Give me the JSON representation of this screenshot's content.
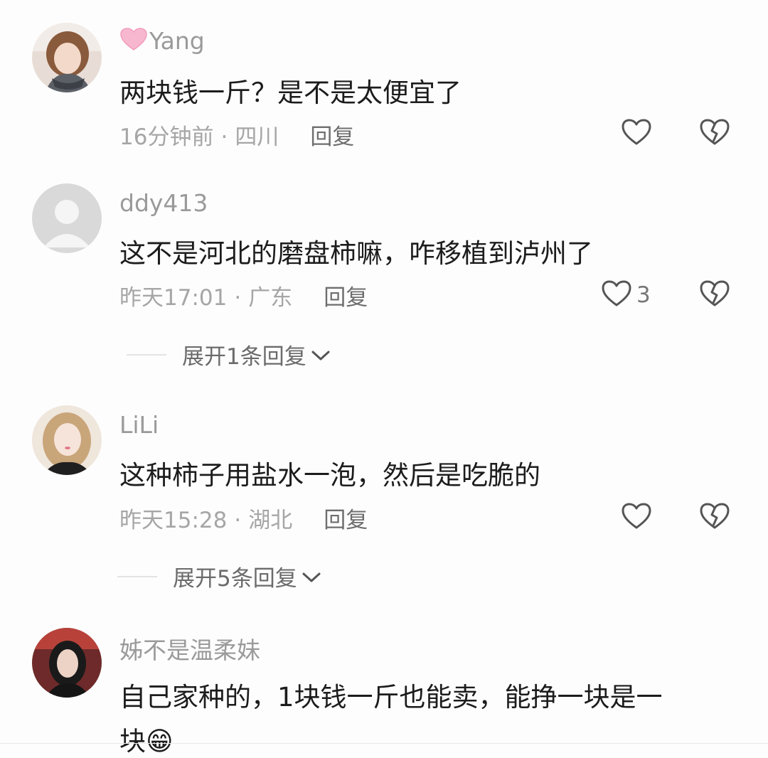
{
  "comments": [
    {
      "username": "Yang",
      "username_prefix_icon": "pink-heart-icon",
      "text": "两块钱一斤？是不是太便宜了",
      "time": "16分钟前",
      "location": "四川",
      "reply_label": "回复",
      "like_count": ""
    },
    {
      "username": "ddy413",
      "text": "这不是河北的磨盘柿嘛，咋移植到泸州了",
      "time": "昨天17:01",
      "location": "广东",
      "reply_label": "回复",
      "like_count": "3",
      "expand_label": "展开1条回复"
    },
    {
      "username": "LiLi",
      "text": "这种柿子用盐水一泡，然后是吃脆的",
      "time": "昨天15:28",
      "location": "湖北",
      "reply_label": "回复",
      "like_count": "",
      "expand_label": "展开5条回复"
    },
    {
      "username": "姊不是温柔妹",
      "text_line1": "自己家种的，1块钱一斤也能卖，能挣一块是一",
      "text_line2": "块😁"
    }
  ],
  "separator": "·",
  "colors": {
    "username": "#9a9a9a",
    "text": "#1c1c1c",
    "meta": "#a6a6a6",
    "reply": "#6e6e6e",
    "icon_stroke": "#555555",
    "heart_emoji": "#f4a9c4"
  }
}
